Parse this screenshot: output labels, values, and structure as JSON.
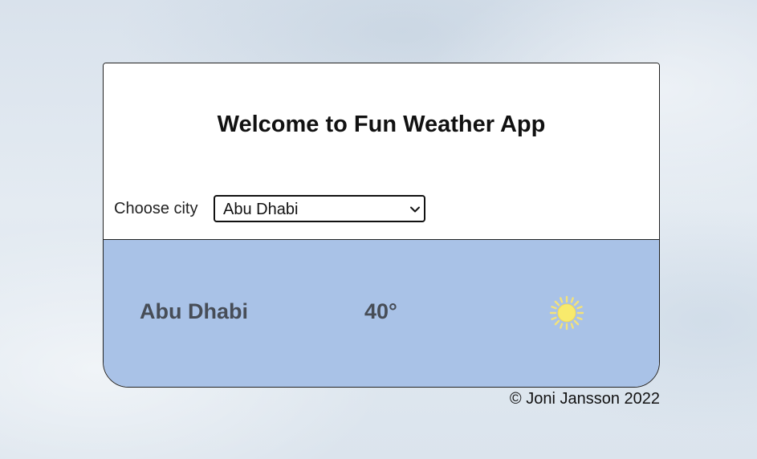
{
  "header": {
    "title": "Welcome to Fun Weather App"
  },
  "city_picker": {
    "label": "Choose city",
    "selected": "Abu Dhabi"
  },
  "weather": {
    "city": "Abu Dhabi",
    "temperature": "40°",
    "icon": "sun-icon",
    "panel_color": "#a9c2e7"
  },
  "footer": {
    "copyright": "© Joni Jansson 2022"
  }
}
